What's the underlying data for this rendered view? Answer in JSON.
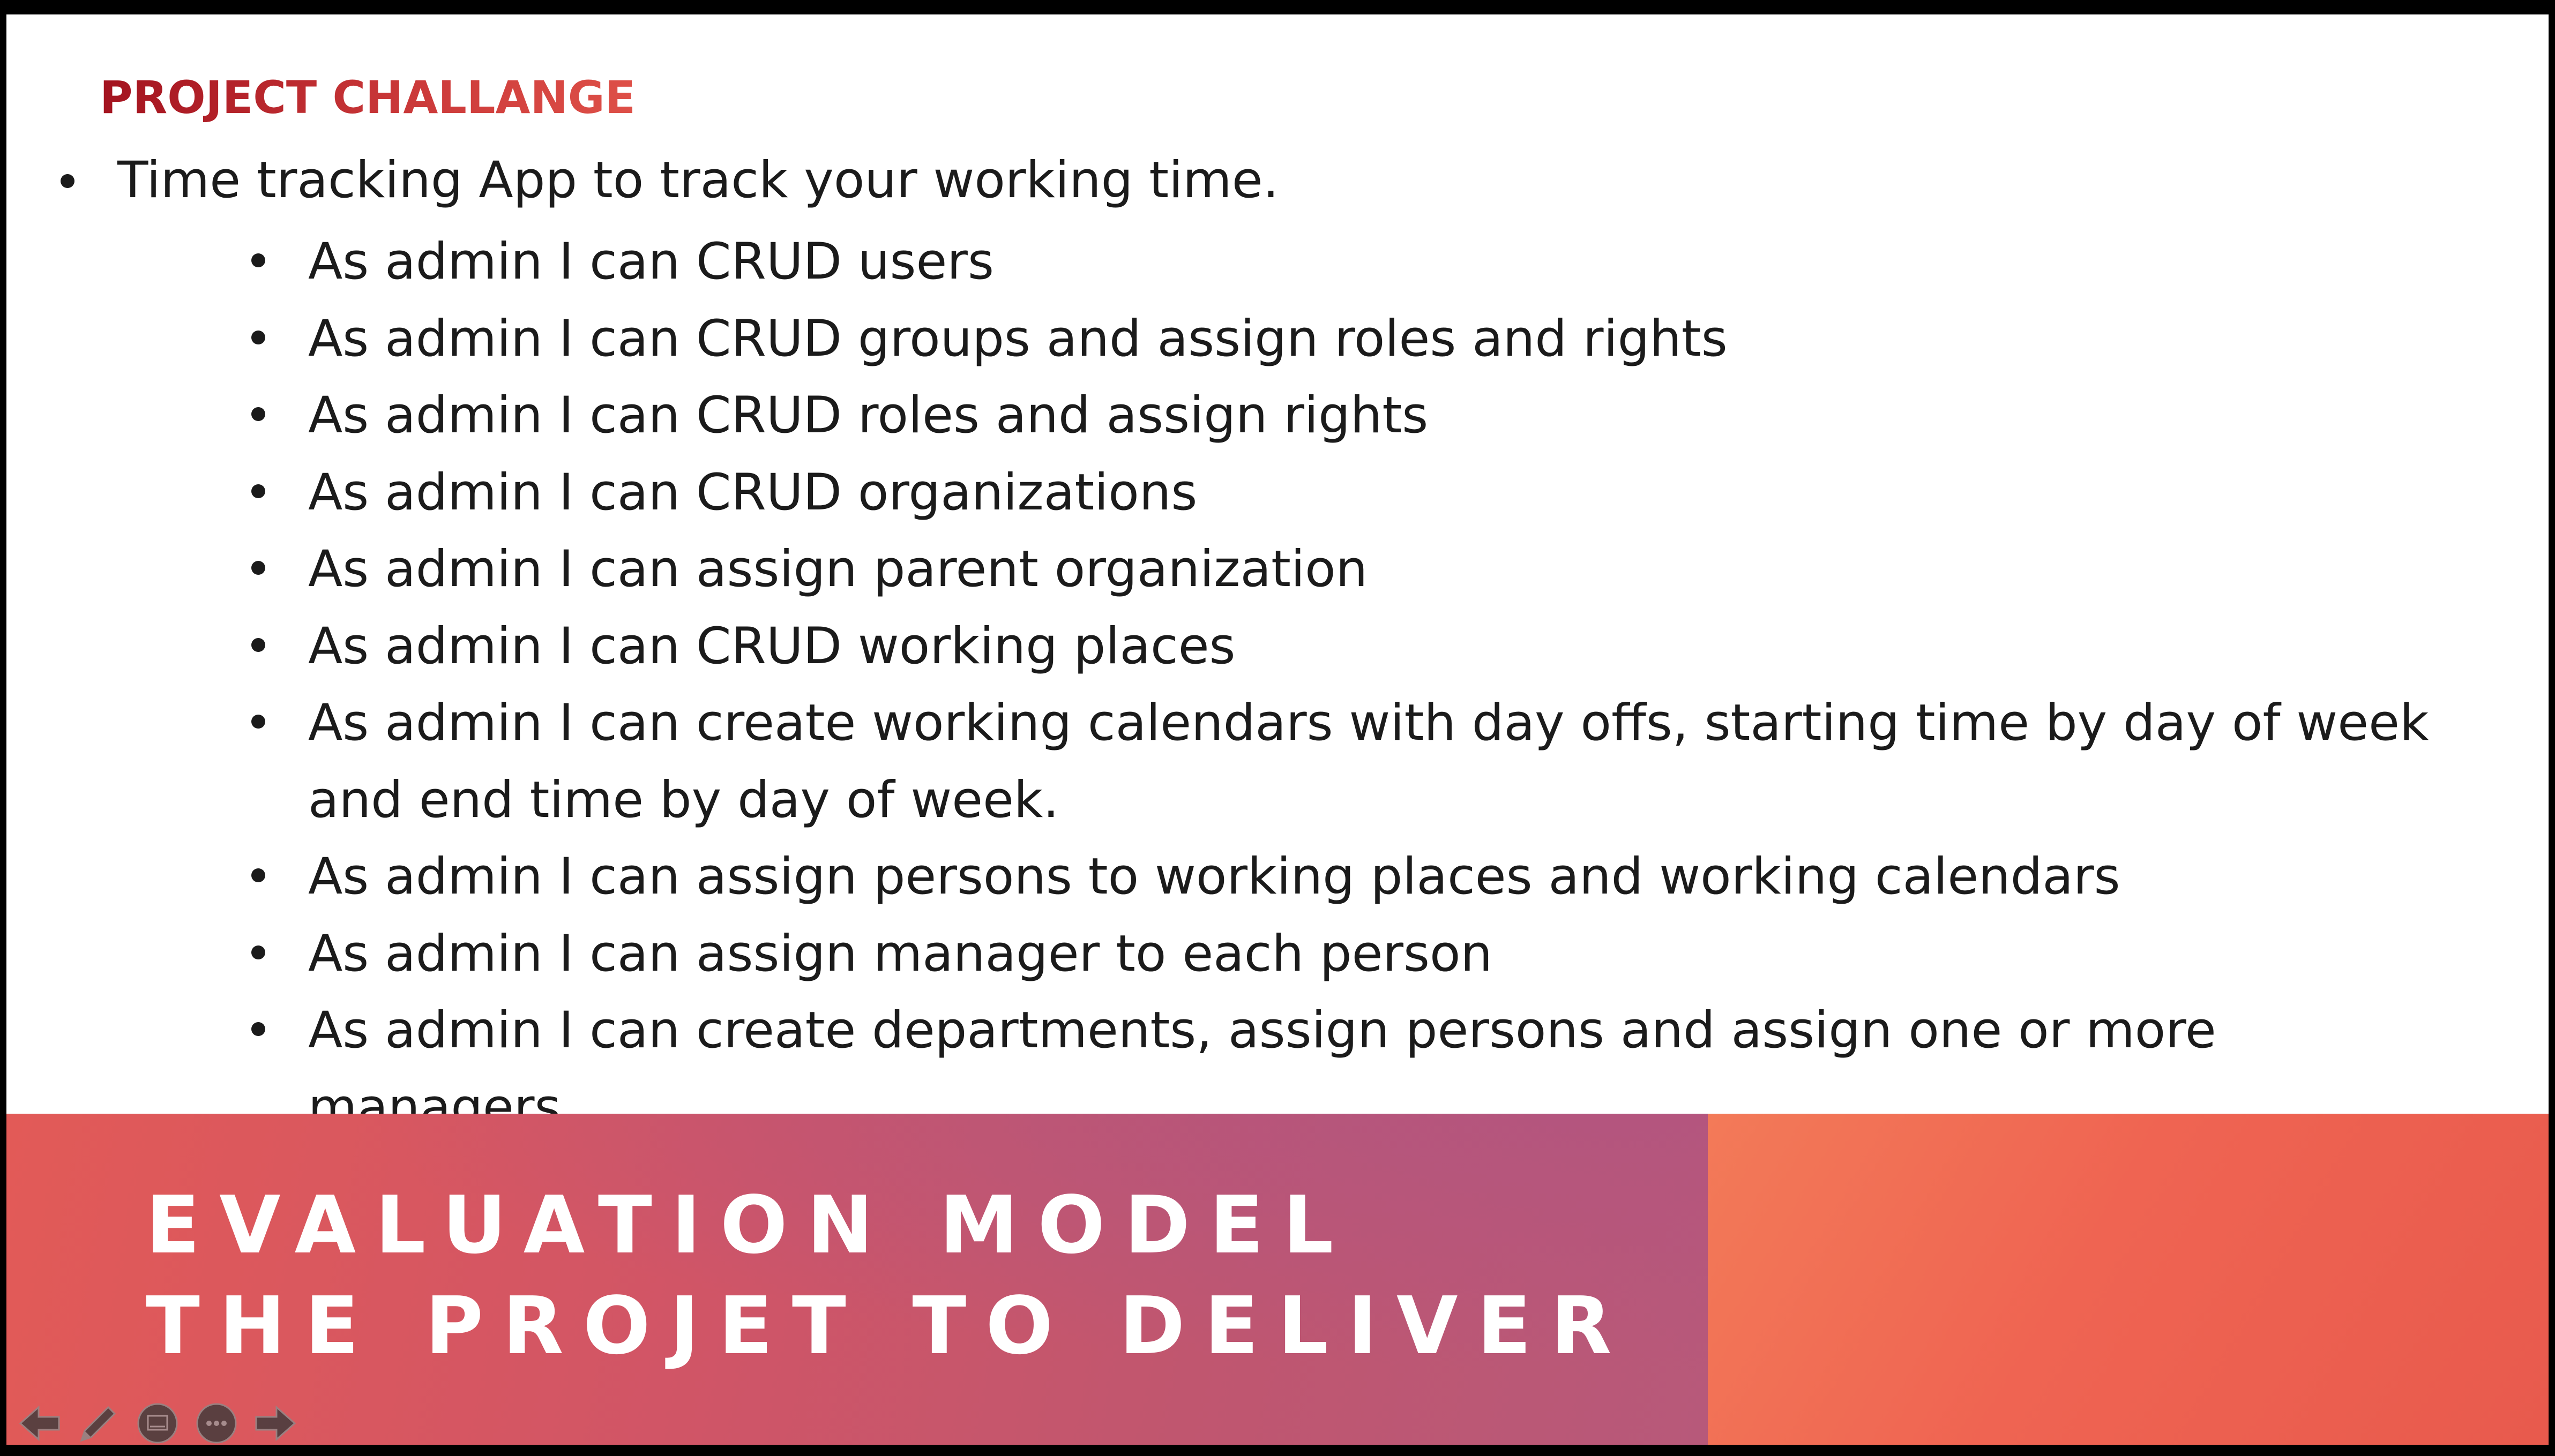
{
  "slide": {
    "heading": "PROJECT CHALLANGE",
    "main_bullet": "Time tracking App to track your working time.",
    "sub_bullets": [
      "As admin I can CRUD users",
      "As admin I can CRUD groups and assign roles and rights",
      "As admin I can CRUD roles and assign rights",
      "As admin I can CRUD organizations",
      "As admin I can assign parent organization",
      "As admin I can CRUD working places",
      "As admin I can create working calendars with day offs, starting time by day of week and end time by day of week.",
      "As admin I can assign persons to working places and working calendars",
      "As admin I can assign manager to each person",
      "As admin I can create departments, assign persons and assign one or more managers"
    ]
  },
  "banner": {
    "line1": "EVALUATION MODEL",
    "line2": "THE PROJET TO DELIVER"
  },
  "controls": [
    {
      "icon": "arrow-left-icon"
    },
    {
      "icon": "pen-icon"
    },
    {
      "icon": "slides-icon"
    },
    {
      "icon": "more-icon"
    },
    {
      "icon": "arrow-right-icon"
    }
  ],
  "colors": {
    "heading": "#b5202b",
    "text": "#1b1b1b",
    "banner_left": "#c0566f",
    "banner_right": "#ef6452"
  }
}
